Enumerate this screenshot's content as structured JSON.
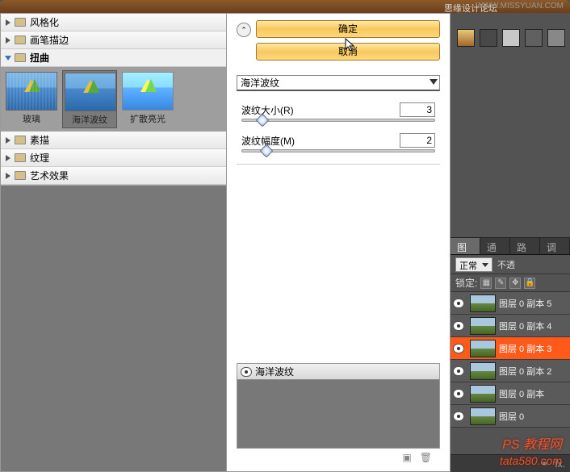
{
  "header": {
    "forum": "思缘设计论坛",
    "url": "WWW.MISSYUAN.COM"
  },
  "tree": {
    "items": [
      {
        "label": "风格化",
        "expanded": false
      },
      {
        "label": "画笔描边",
        "expanded": false
      },
      {
        "label": "扭曲",
        "expanded": true
      },
      {
        "label": "素描",
        "expanded": false
      },
      {
        "label": "纹理",
        "expanded": false
      },
      {
        "label": "艺术效果",
        "expanded": false
      }
    ]
  },
  "thumbs": [
    {
      "label": "玻璃",
      "selected": false
    },
    {
      "label": "海洋波纹",
      "selected": true
    },
    {
      "label": "扩散亮光",
      "selected": false
    }
  ],
  "buttons": {
    "ok": "确定",
    "cancel": "取消"
  },
  "filter": {
    "name": "海洋波纹",
    "params": [
      {
        "label": "波纹大小(R)",
        "value": "3",
        "pos": 8
      },
      {
        "label": "波纹幅度(M)",
        "value": "2",
        "pos": 10
      }
    ]
  },
  "stack": {
    "item": "海洋波纹"
  },
  "layersPanel": {
    "tabs": [
      "图层",
      "通道",
      "路径",
      "调整"
    ],
    "blend": "正常",
    "opacityLabel": "不透",
    "lockLabel": "锁定:",
    "layers": [
      {
        "name": "图层 0 副本 5",
        "selected": false
      },
      {
        "name": "图层 0 副本 4",
        "selected": false
      },
      {
        "name": "图层 0 副本 3",
        "selected": true
      },
      {
        "name": "图层 0 副本 2",
        "selected": false
      },
      {
        "name": "图层 0 副本",
        "selected": false
      },
      {
        "name": "图层 0",
        "selected": false
      }
    ],
    "footer": "fx."
  },
  "watermark": {
    "line1": "PS 教程网",
    "line2": "tata580.com"
  },
  "swatches": [
    "#d8a858",
    "#484848",
    "#c8c8c8",
    "#606060",
    "#888888"
  ]
}
